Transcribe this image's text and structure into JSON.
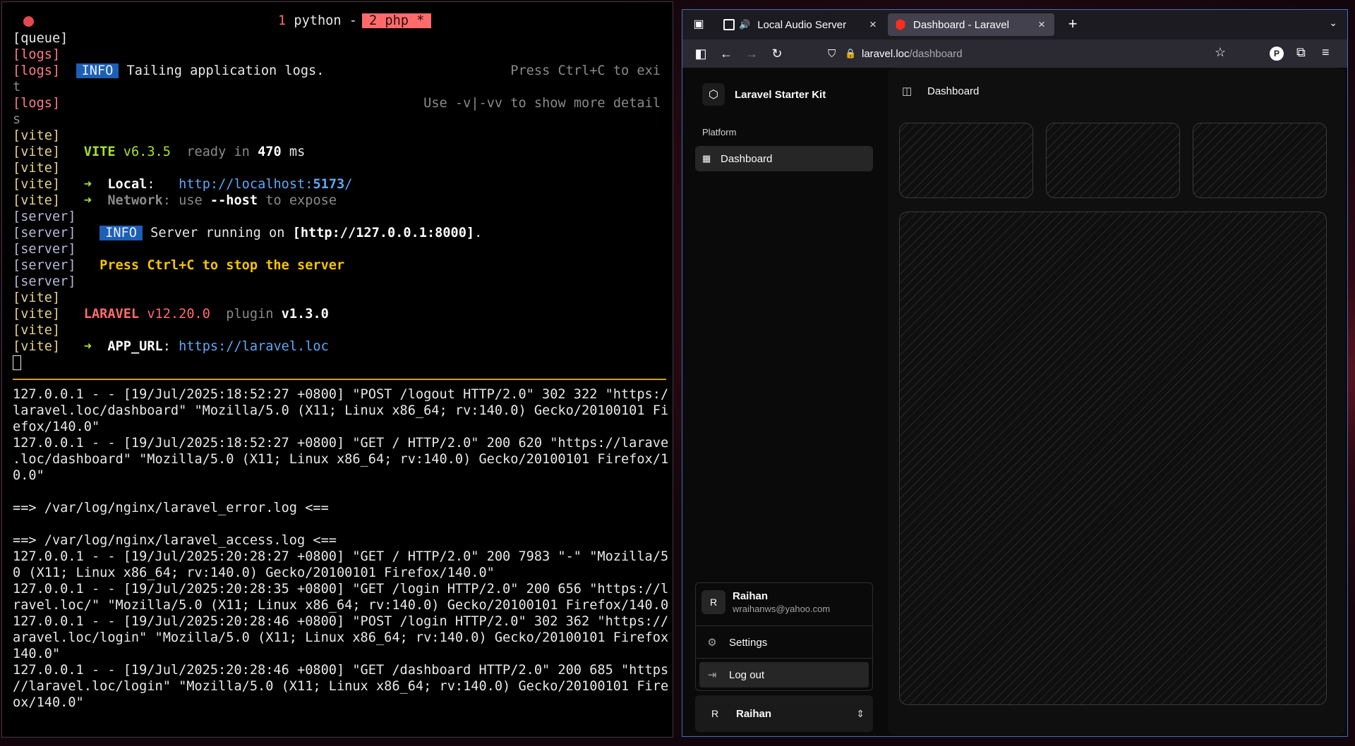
{
  "terminal": {
    "tabs": {
      "tab1_num": "1",
      "tab1_label": " python - ",
      "tab2_label": "2 php *"
    },
    "lines": [
      {
        "prefix": "[queue]",
        "cls": "c-queue",
        "text": ""
      },
      {
        "prefix": "[logs]",
        "cls": "c-logs",
        "text": ""
      },
      {
        "prefix": "[logs]",
        "cls": "c-logs",
        "badge": "INFO",
        "text": " Tailing application logs.",
        "right": "Press Ctrl+C to exi"
      },
      {
        "prefix": "t",
        "cls": "c-dim",
        "text": ""
      },
      {
        "prefix": "[logs]",
        "cls": "c-logs",
        "text": "",
        "right": "Use -v|-vv to show more detail"
      },
      {
        "prefix": "s",
        "cls": "c-dim",
        "text": ""
      },
      {
        "prefix": "[vite]",
        "cls": "c-vite",
        "text": ""
      }
    ],
    "vite_header": {
      "name": "VITE",
      "version": "v6.3.5",
      "ready": "ready in",
      "ms_value": "470",
      "ms_unit": "ms"
    },
    "local": {
      "arrow": "➜",
      "label": "Local",
      "url_prefix": "http://localhost:",
      "port": "5173",
      "url_suffix": "/"
    },
    "network": {
      "arrow": "➜",
      "label": "Network",
      "text_before": ": use ",
      "flag": "--host",
      "text_after": " to expose"
    },
    "server_info": {
      "badge": "INFO",
      "text_before": " Server running on ",
      "address": "[http://127.0.0.1:8000]",
      "text_after": "."
    },
    "server_stop": "Press Ctrl+C to stop the server",
    "laravel": {
      "name": "LARAVEL",
      "version": "v12.20.0",
      "plugin_label": "plugin",
      "plugin_version": "v1.3.0"
    },
    "app_url": {
      "arrow": "➜",
      "label": "APP_URL",
      "sep": ": ",
      "url": "https://laravel.loc"
    },
    "prefixes": {
      "vite": "[vite]",
      "server": "[server]"
    },
    "log_lines": [
      "127.0.0.1 - - [19/Jul/2025:18:52:27 +0800] \"POST /logout HTTP/2.0\" 302 322 \"https://",
      "laravel.loc/dashboard\" \"Mozilla/5.0 (X11; Linux x86_64; rv:140.0) Gecko/20100101 Fir",
      "efox/140.0\"",
      "127.0.0.1 - - [19/Jul/2025:18:52:27 +0800] \"GET / HTTP/2.0\" 200 620 \"https://laravel",
      ".loc/dashboard\" \"Mozilla/5.0 (X11; Linux x86_64; rv:140.0) Gecko/20100101 Firefox/14",
      "0.0\"",
      "",
      "==> /var/log/nginx/laravel_error.log <==",
      "",
      "==> /var/log/nginx/laravel_access.log <==",
      "127.0.0.1 - - [19/Jul/2025:20:28:27 +0800] \"GET / HTTP/2.0\" 200 7983 \"-\" \"Mozilla/5.",
      "0 (X11; Linux x86_64; rv:140.0) Gecko/20100101 Firefox/140.0\"",
      "127.0.0.1 - - [19/Jul/2025:20:28:35 +0800] \"GET /login HTTP/2.0\" 200 656 \"https://la",
      "ravel.loc/\" \"Mozilla/5.0 (X11; Linux x86_64; rv:140.0) Gecko/20100101 Firefox/140.0\"",
      "127.0.0.1 - - [19/Jul/2025:20:28:46 +0800] \"POST /login HTTP/2.0\" 302 362 \"https://l",
      "aravel.loc/login\" \"Mozilla/5.0 (X11; Linux x86_64; rv:140.0) Gecko/20100101 Firefox/",
      "140.0\"",
      "127.0.0.1 - - [19/Jul/2025:20:28:46 +0800] \"GET /dashboard HTTP/2.0\" 200 685 \"https:",
      "//laravel.loc/login\" \"Mozilla/5.0 (X11; Linux x86_64; rv:140.0) Gecko/20100101 Firef",
      "ox/140.0\""
    ]
  },
  "browser": {
    "tabs": [
      {
        "title": "Local Audio Server",
        "active": false
      },
      {
        "title": "Dashboard - Laravel",
        "active": true
      }
    ],
    "url": {
      "host": "laravel.loc",
      "path": "/dashboard"
    },
    "extension_label": "P"
  },
  "app": {
    "brand": "Laravel Starter Kit",
    "group_label": "Platform",
    "nav": [
      {
        "label": "Dashboard"
      }
    ],
    "breadcrumb": "Dashboard",
    "user": {
      "initial": "R",
      "name": "Raihan",
      "email": "wraihanws@yahoo.com"
    },
    "user_menu": {
      "settings": "Settings",
      "logout": "Log out"
    }
  },
  "colors": {
    "terminal_accent": "#ff6b6b",
    "info_badge": "#1d5fb4",
    "divider": "#d4a020",
    "browser_focus_border": "#3f6fbf",
    "laravel_red": "#ff2d20"
  }
}
